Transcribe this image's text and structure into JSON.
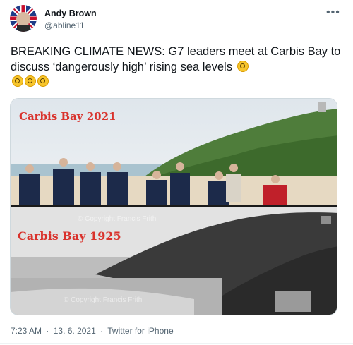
{
  "author": {
    "name": "Andy Brown",
    "handle": "@abline11"
  },
  "tweet": {
    "text": "BREAKING CLIMATE NEWS: G7 leaders meet at Carbis Bay to discuss ‘dangerously high’ rising sea levels"
  },
  "media": {
    "top_caption": "Carbis Bay 2021",
    "bottom_caption": "Carbis Bay 1925",
    "watermark_1": "© Copyright Francis Frith",
    "watermark_2": "© Copyright Francis Frith"
  },
  "meta": {
    "time": "7:23 AM",
    "sep1": "·",
    "date": "13. 6. 2021",
    "sep2": "·",
    "source": "Twitter for iPhone"
  },
  "icons": {
    "more": "more-options-icon",
    "emoji": "face-with-monocle-icon"
  },
  "colors": {
    "caption": "#d9322c",
    "secondary_text": "#536471"
  }
}
